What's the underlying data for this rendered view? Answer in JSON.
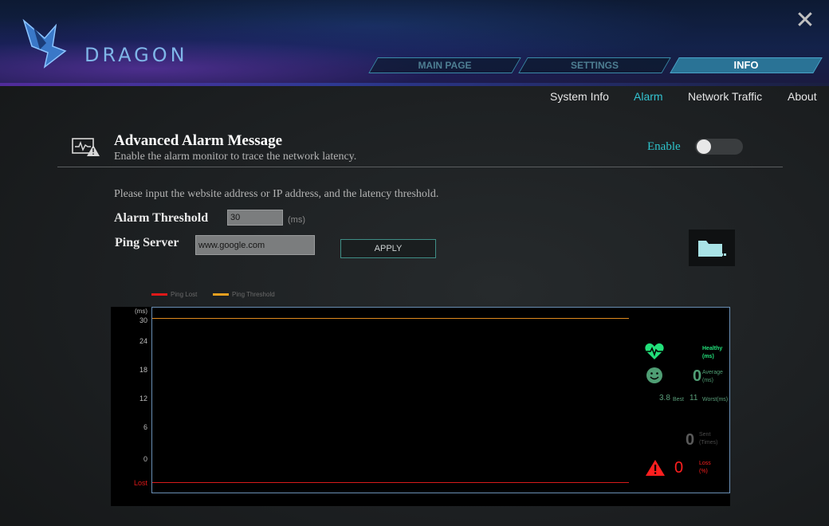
{
  "app": {
    "brand": "DRAGON"
  },
  "tabs": [
    {
      "label": "MAIN PAGE",
      "active": false
    },
    {
      "label": "SETTINGS",
      "active": false
    },
    {
      "label": "INFO",
      "active": true
    }
  ],
  "subnav": [
    {
      "label": "System Info",
      "active": false
    },
    {
      "label": "Alarm",
      "active": true
    },
    {
      "label": "Network Traffic",
      "active": false
    },
    {
      "label": "About",
      "active": false
    }
  ],
  "alarm": {
    "title": "Advanced Alarm Message",
    "subtitle": "Enable the alarm monitor to trace the network latency.",
    "enable_label": "Enable",
    "enabled": false,
    "instruction": "Please input the website address or IP address, and the latency threshold.",
    "threshold_label": "Alarm Threshold",
    "threshold_value": "30",
    "threshold_unit": "(ms)",
    "ping_label": "Ping Server",
    "ping_value": "www.google.com",
    "apply_label": "APPLY"
  },
  "chart_data": {
    "type": "line",
    "legend": [
      {
        "name": "Ping Lost",
        "color": "#e01919"
      },
      {
        "name": "Ping Threshold",
        "color": "#e8a020"
      }
    ],
    "ylabel": "(ms)",
    "y_ticks": [
      "30",
      "24",
      "18",
      "12",
      "6",
      "0",
      "Lost"
    ],
    "ylim": [
      0,
      30
    ],
    "threshold": 30,
    "series": [],
    "legend_placement": "top-left"
  },
  "stats": {
    "healthy_label": "Healthy",
    "healthy_unit": "(ms)",
    "average_value": "0",
    "average_label": "Average",
    "average_unit": "(ms)",
    "best_value": "3.8",
    "best_label": "Best",
    "worst_value": "11",
    "worst_label": "Worst(ms)",
    "sent_value": "0",
    "sent_label": "Sent",
    "sent_unit": "(Times)",
    "loss_value": "0",
    "loss_label": "Loss",
    "loss_unit": "(%)"
  },
  "colors": {
    "accent": "#33c3d1",
    "healthy": "#22e07a",
    "average": "#4f9e74",
    "loss": "#ff1f1f",
    "threshold": "#e08a1f"
  },
  "icons": {
    "close": "close-icon",
    "alarm": "alarm-monitor-icon",
    "folder": "folder-icon",
    "heart": "heart-pulse-icon",
    "smiley": "smiley-icon",
    "warning": "warning-icon"
  }
}
